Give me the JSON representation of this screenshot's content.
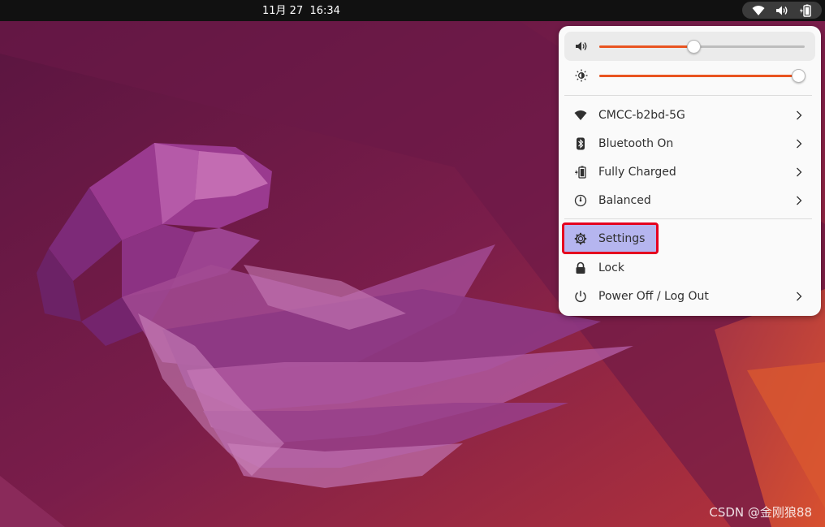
{
  "topbar": {
    "clock": "11月 27  16:34",
    "tray_icons": [
      "wifi-icon",
      "volume-icon",
      "battery-icon"
    ]
  },
  "quick_settings": {
    "volume": {
      "icon": "volume-icon",
      "level_percent": 46
    },
    "brightness": {
      "icon": "brightness-icon",
      "level_percent": 97
    },
    "network": {
      "icon": "wifi-icon",
      "label": "CMCC-b2bd-5G"
    },
    "bluetooth": {
      "icon": "bluetooth-icon",
      "label": "Bluetooth On"
    },
    "battery": {
      "icon": "battery-icon",
      "label": "Fully Charged"
    },
    "power_mode": {
      "icon": "power-mode-icon",
      "label": "Balanced"
    },
    "settings": {
      "icon": "settings-icon",
      "label": "Settings"
    },
    "lock": {
      "icon": "lock-icon",
      "label": "Lock"
    },
    "power_off": {
      "icon": "power-icon",
      "label": "Power Off / Log Out"
    }
  },
  "watermark": "CSDN @金刚狼88",
  "colors": {
    "accent": "#e95420",
    "highlight": "#b5b5ef",
    "highlight_border": "#e5001f",
    "topbar": "#111111",
    "menu_bg": "#fafafa"
  }
}
